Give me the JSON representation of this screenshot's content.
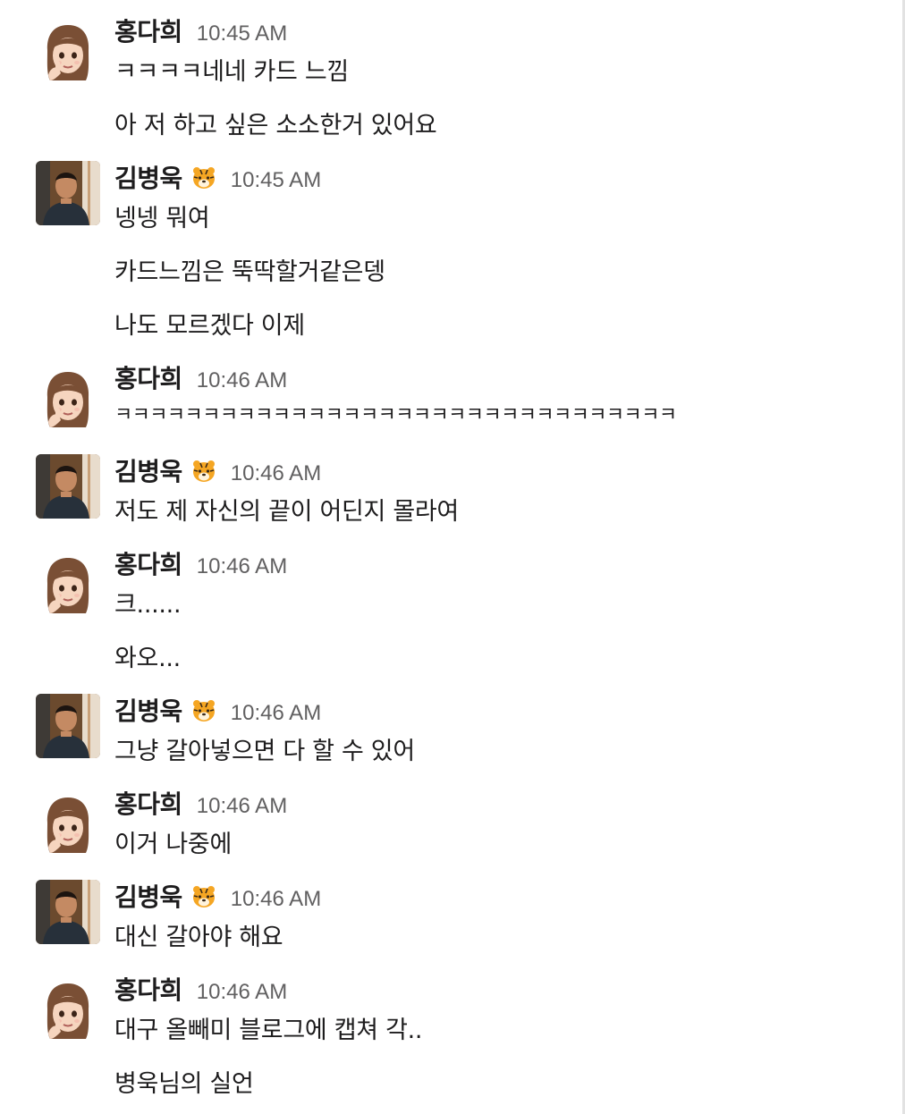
{
  "messages": [
    {
      "sender": "홍다희",
      "time": "10:45 AM",
      "lines": [
        "ㅋㅋㅋㅋ네네 카드 느낌",
        "아 저 하고 싶은 소소한거 있어요"
      ]
    },
    {
      "sender": "김병욱",
      "time": "10:45 AM",
      "emoji": "tiger-face",
      "lines": [
        "넹넹 뭐여",
        "카드느낌은 뚝딱할거같은뎅",
        "나도 모르겠다 이제"
      ]
    },
    {
      "sender": "홍다희",
      "time": "10:46 AM",
      "lines": [
        "ㅋㅋㅋㅋㅋㅋㅋㅋㅋㅋㅋㅋㅋㅋㅋㅋㅋㅋㅋㅋㅋㅋㅋㅋㅋㅋㅋㅋㅋㅋㅋㅋ"
      ]
    },
    {
      "sender": "김병욱",
      "time": "10:46 AM",
      "emoji": "tiger-face",
      "lines": [
        "저도 제 자신의 끝이 어딘지 몰라여"
      ]
    },
    {
      "sender": "홍다희",
      "time": "10:46 AM",
      "lines": [
        "크......",
        "와오..."
      ]
    },
    {
      "sender": "김병욱",
      "time": "10:46 AM",
      "emoji": "tiger-face",
      "lines": [
        "그냥 갈아넣으면 다 할 수 있어"
      ]
    },
    {
      "sender": "홍다희",
      "time": "10:46 AM",
      "lines": [
        "이거 나중에"
      ]
    },
    {
      "sender": "김병욱",
      "time": "10:46 AM",
      "emoji": "tiger-face",
      "lines": [
        "대신 갈아야 해요"
      ]
    },
    {
      "sender": "홍다희",
      "time": "10:46 AM",
      "lines": [
        "대구 올빼미 블로그에 캡쳐 각..",
        "병욱님의 실언"
      ]
    }
  ],
  "colors": {
    "name": "#1d1c1d",
    "timestamp": "#616061",
    "text": "#1d1c1d",
    "background": "#ffffff"
  }
}
